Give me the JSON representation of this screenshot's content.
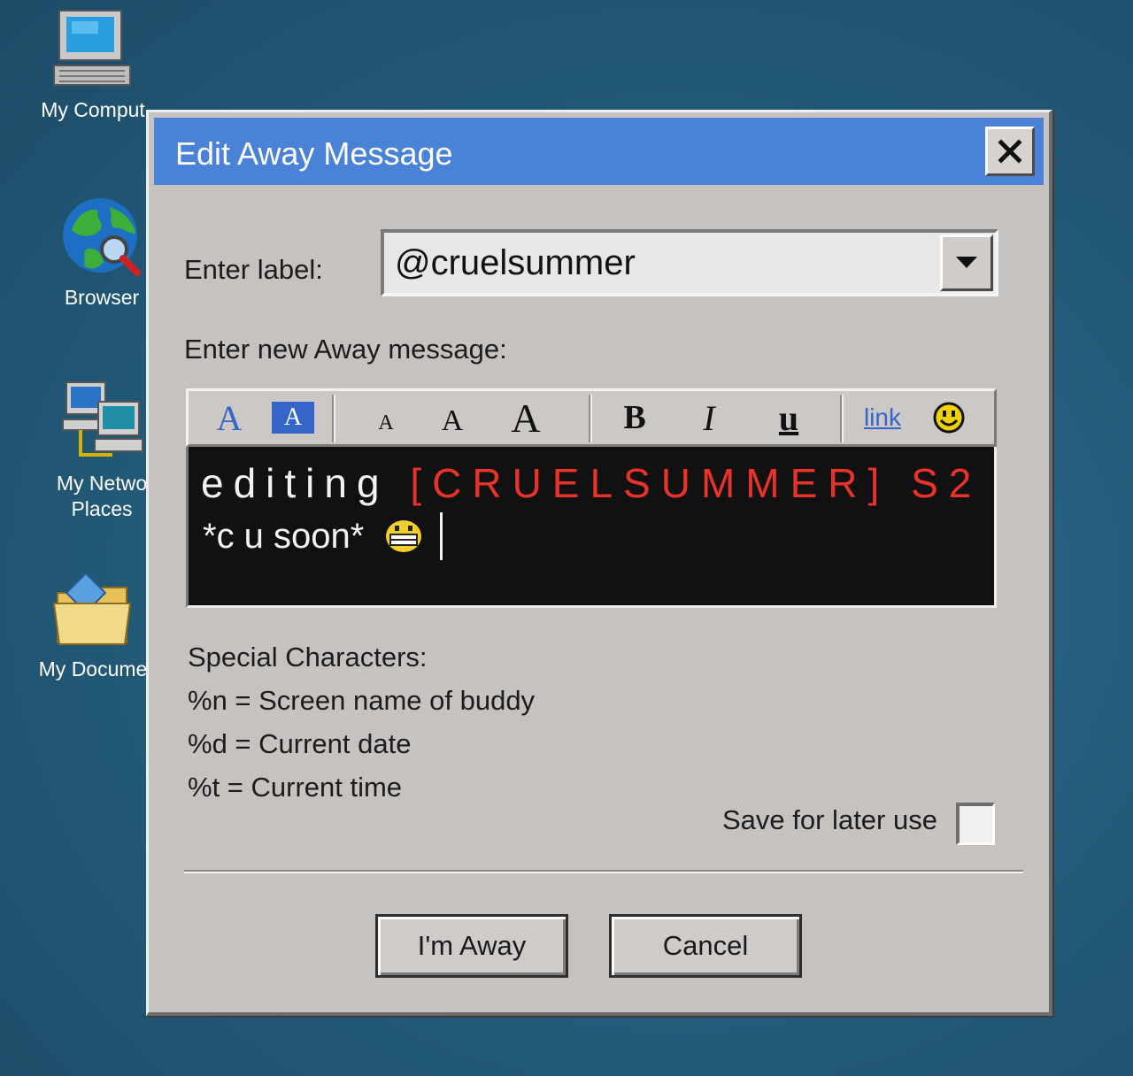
{
  "desktop": {
    "icons": [
      {
        "label": "My Comput",
        "icon": "computer-icon"
      },
      {
        "label": "Browser",
        "icon": "globe-browser-icon"
      },
      {
        "label": "My Netwo",
        "label2": "Places",
        "icon": "network-icon"
      },
      {
        "label": "My Docume",
        "icon": "documents-folder-icon"
      }
    ]
  },
  "dialog": {
    "title": "Edit Away Message",
    "close_icon": "close-icon",
    "label_prompt": "Enter label:",
    "label_value": "@cruelsummer",
    "message_prompt": "Enter new Away message:",
    "toolbar": {
      "text_color": "A",
      "bg_color": "A",
      "size_small": "A",
      "size_medium": "A",
      "size_large": "A",
      "bold": "B",
      "italic": "I",
      "underline": "u",
      "link": "link",
      "smiley_icon": "smiley-icon"
    },
    "message": {
      "line1_white": "editing",
      "line1_red": "[CRUELSUMMER]",
      "line1_tail": "S2",
      "line2": "*c u soon*",
      "emoji_icon": "grinning-emoji-icon"
    },
    "special": {
      "heading": "Special Characters:",
      "items": [
        "%n = Screen name of buddy",
        "%d = Current date",
        "%t = Current time"
      ]
    },
    "save_label": "Save for later use",
    "save_checked": false,
    "buttons": {
      "away": "I'm Away",
      "cancel": "Cancel"
    },
    "colors": {
      "titlebar": "#4a82d8",
      "dialog_bg": "#c6c2bf",
      "editor_bg": "#111111",
      "red_text": "#e8322a",
      "toolbar_blue": "#3565c9",
      "smiley_yellow": "#f0d200"
    }
  }
}
